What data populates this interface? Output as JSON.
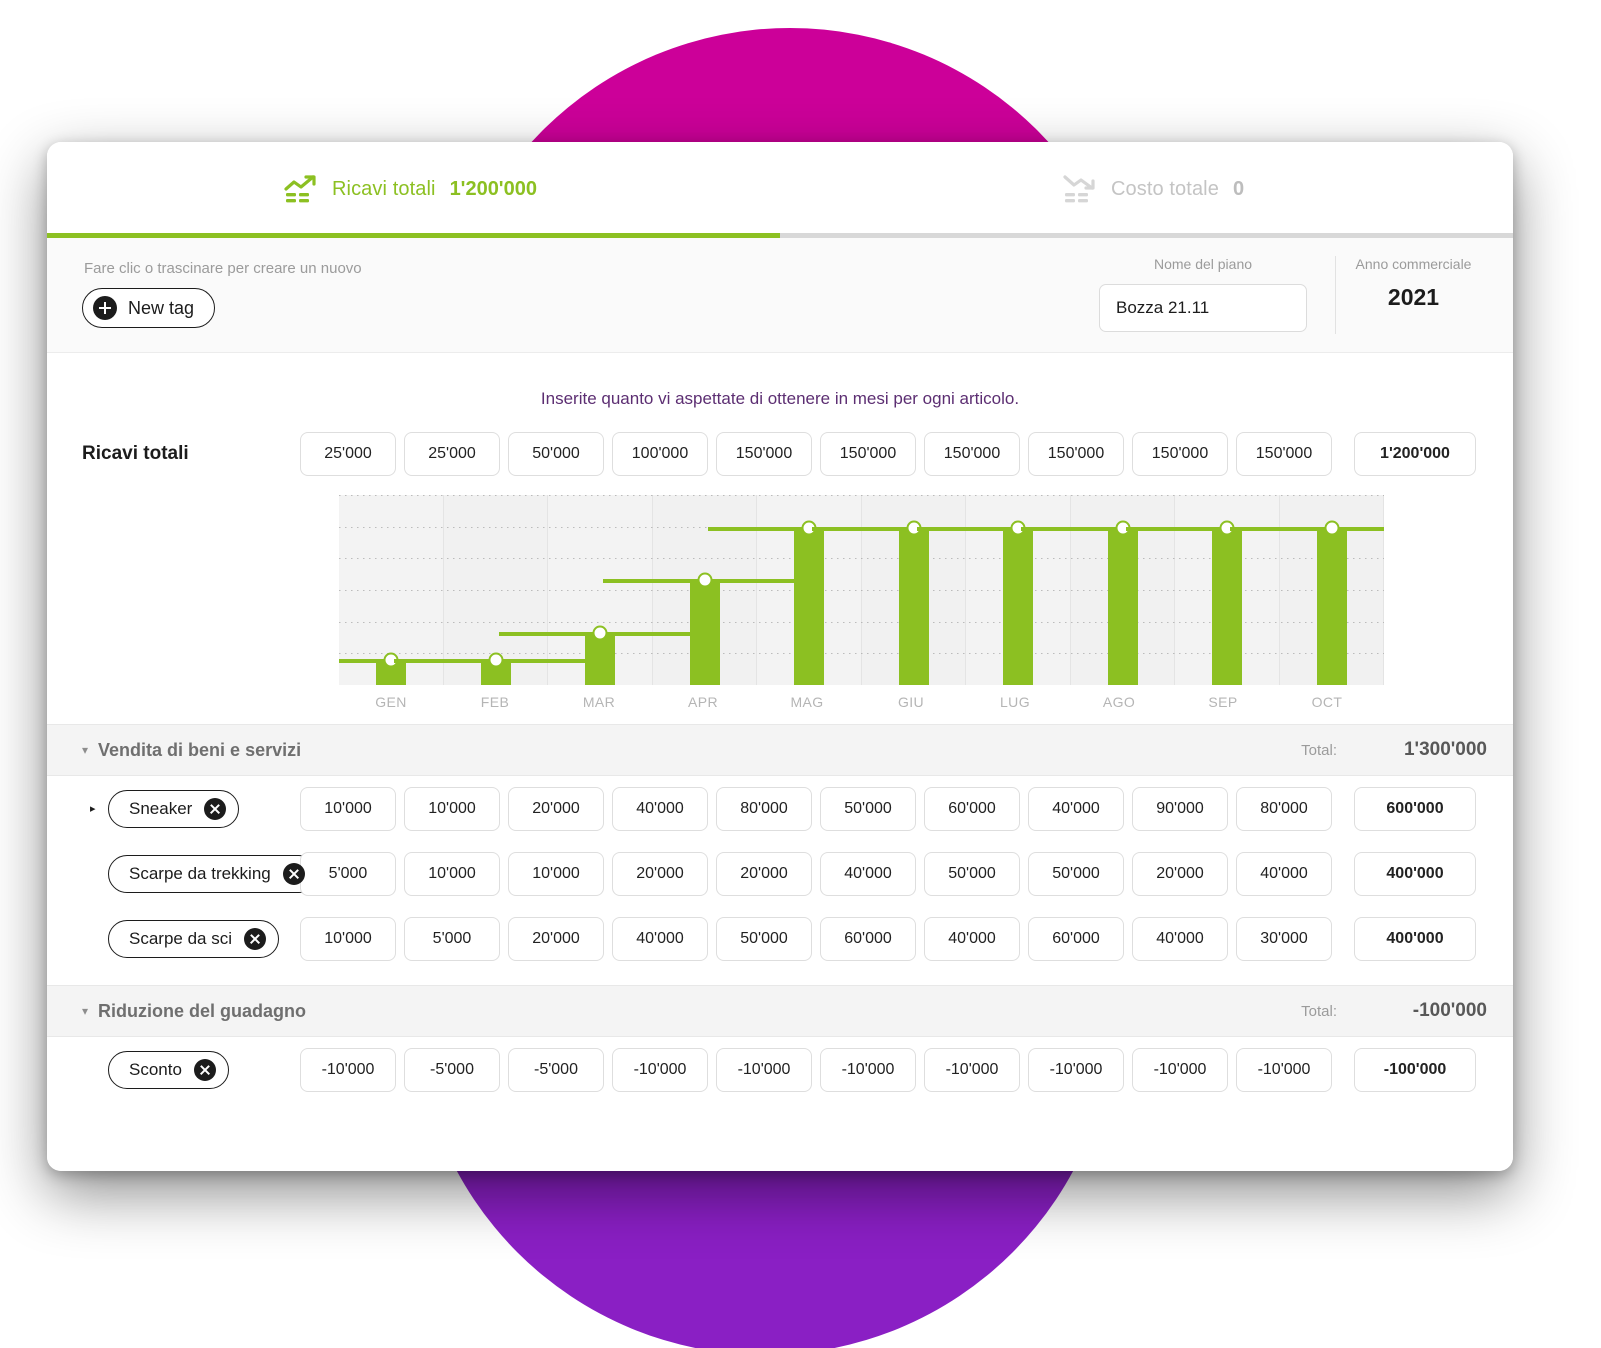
{
  "summary": {
    "revenue": {
      "icon": "trend-up-icon",
      "label": "Ricavi totali",
      "value": "1'200'000",
      "color": "#8cc022"
    },
    "cost": {
      "icon": "trend-down-icon",
      "label": "Costo totale",
      "value": "0",
      "color": "#bdbdbd"
    },
    "progress_percent": 50
  },
  "toolbar": {
    "hint": "Fare clic o trascinare per creare un nuovo",
    "new_tag_label": "New tag",
    "plan_caption": "Nome del piano",
    "plan_name_value": "Bozza 21.11",
    "plan_name_placeholder": "Nome del piano",
    "year_caption": "Anno commerciale",
    "year_value": "2021"
  },
  "instruction": "Inserite quanto vi aspettate di ottenere in mesi per ogni articolo.",
  "totals_row": {
    "label": "Ricavi totali",
    "values": [
      "25'000",
      "25'000",
      "50'000",
      "100'000",
      "150'000",
      "150'000",
      "150'000",
      "150'000",
      "150'000",
      "150'000"
    ],
    "total": "1'200'000"
  },
  "chart_data": {
    "type": "bar",
    "title": "Ricavi totali",
    "xlabel": "",
    "ylabel": "",
    "categories": [
      "GEN",
      "FEB",
      "MAR",
      "APR",
      "MAG",
      "GIU",
      "LUG",
      "AGO",
      "SEP",
      "OCT"
    ],
    "values": [
      25000,
      25000,
      50000,
      100000,
      150000,
      150000,
      150000,
      150000,
      150000,
      150000
    ],
    "ylim": [
      0,
      180000
    ],
    "grid": true,
    "legend": "none",
    "series": [
      {
        "name": "Ricavi totali",
        "values": [
          25000,
          25000,
          50000,
          100000,
          150000,
          150000,
          150000,
          150000,
          150000,
          150000
        ],
        "color": "#8cc022"
      }
    ]
  },
  "groups": [
    {
      "caret": "▾",
      "title": "Vendita di beni e servizi",
      "total_label": "Total:",
      "total_value": "1'300'000",
      "rows": [
        {
          "caret": "▸",
          "tag": "Sneaker",
          "remove_icon": "close-circle-icon",
          "expandable": true,
          "values": [
            "10'000",
            "10'000",
            "20'000",
            "40'000",
            "80'000",
            "50'000",
            "60'000",
            "40'000",
            "90'000",
            "80'000"
          ],
          "total": "600'000"
        },
        {
          "caret": "",
          "tag": "Scarpe da trekking",
          "remove_icon": "close-circle-icon",
          "expandable": false,
          "values": [
            "5'000",
            "10'000",
            "10'000",
            "20'000",
            "20'000",
            "40'000",
            "50'000",
            "50'000",
            "20'000",
            "40'000"
          ],
          "total": "400'000"
        },
        {
          "caret": "",
          "tag": "Scarpe da sci",
          "remove_icon": "close-circle-icon",
          "expandable": false,
          "values": [
            "10'000",
            "5'000",
            "20'000",
            "40'000",
            "50'000",
            "60'000",
            "40'000",
            "60'000",
            "40'000",
            "30'000"
          ],
          "total": "400'000"
        }
      ]
    },
    {
      "caret": "▾",
      "title": "Riduzione del guadagno",
      "total_label": "Total:",
      "total_value": "-100'000",
      "rows": [
        {
          "caret": "",
          "tag": "Sconto",
          "remove_icon": "close-circle-icon",
          "expandable": false,
          "values": [
            "-10'000",
            "-5'000",
            "-5'000",
            "-10'000",
            "-10'000",
            "-10'000",
            "-10'000",
            "-10'000",
            "-10'000",
            "-10'000"
          ],
          "total": "-100'000"
        }
      ]
    }
  ]
}
